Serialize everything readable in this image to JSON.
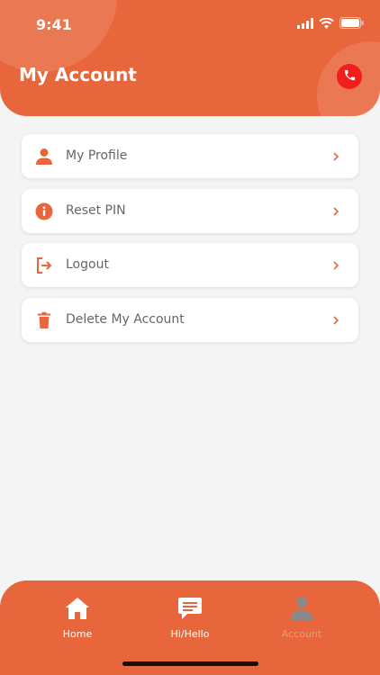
{
  "status_bar": {
    "time": "9:41"
  },
  "header": {
    "title": "My Account"
  },
  "menu": {
    "items": [
      {
        "label": "My Profile",
        "icon": "person-icon"
      },
      {
        "label": "Reset PIN",
        "icon": "info-icon"
      },
      {
        "label": "Logout",
        "icon": "logout-icon"
      },
      {
        "label": "Delete My Account",
        "icon": "trash-icon"
      }
    ]
  },
  "tabbar": {
    "items": [
      {
        "label": "Home",
        "icon": "home-icon",
        "active": true
      },
      {
        "label": "Hi/Hello",
        "icon": "chat-icon",
        "active": true
      },
      {
        "label": "Account",
        "icon": "person-icon",
        "active": false
      }
    ]
  },
  "colors": {
    "primary": "#e8663b",
    "call_button": "#f21d1d",
    "background": "#f4f4f4",
    "card": "#ffffff",
    "inactive_tab": "#e19a80"
  }
}
